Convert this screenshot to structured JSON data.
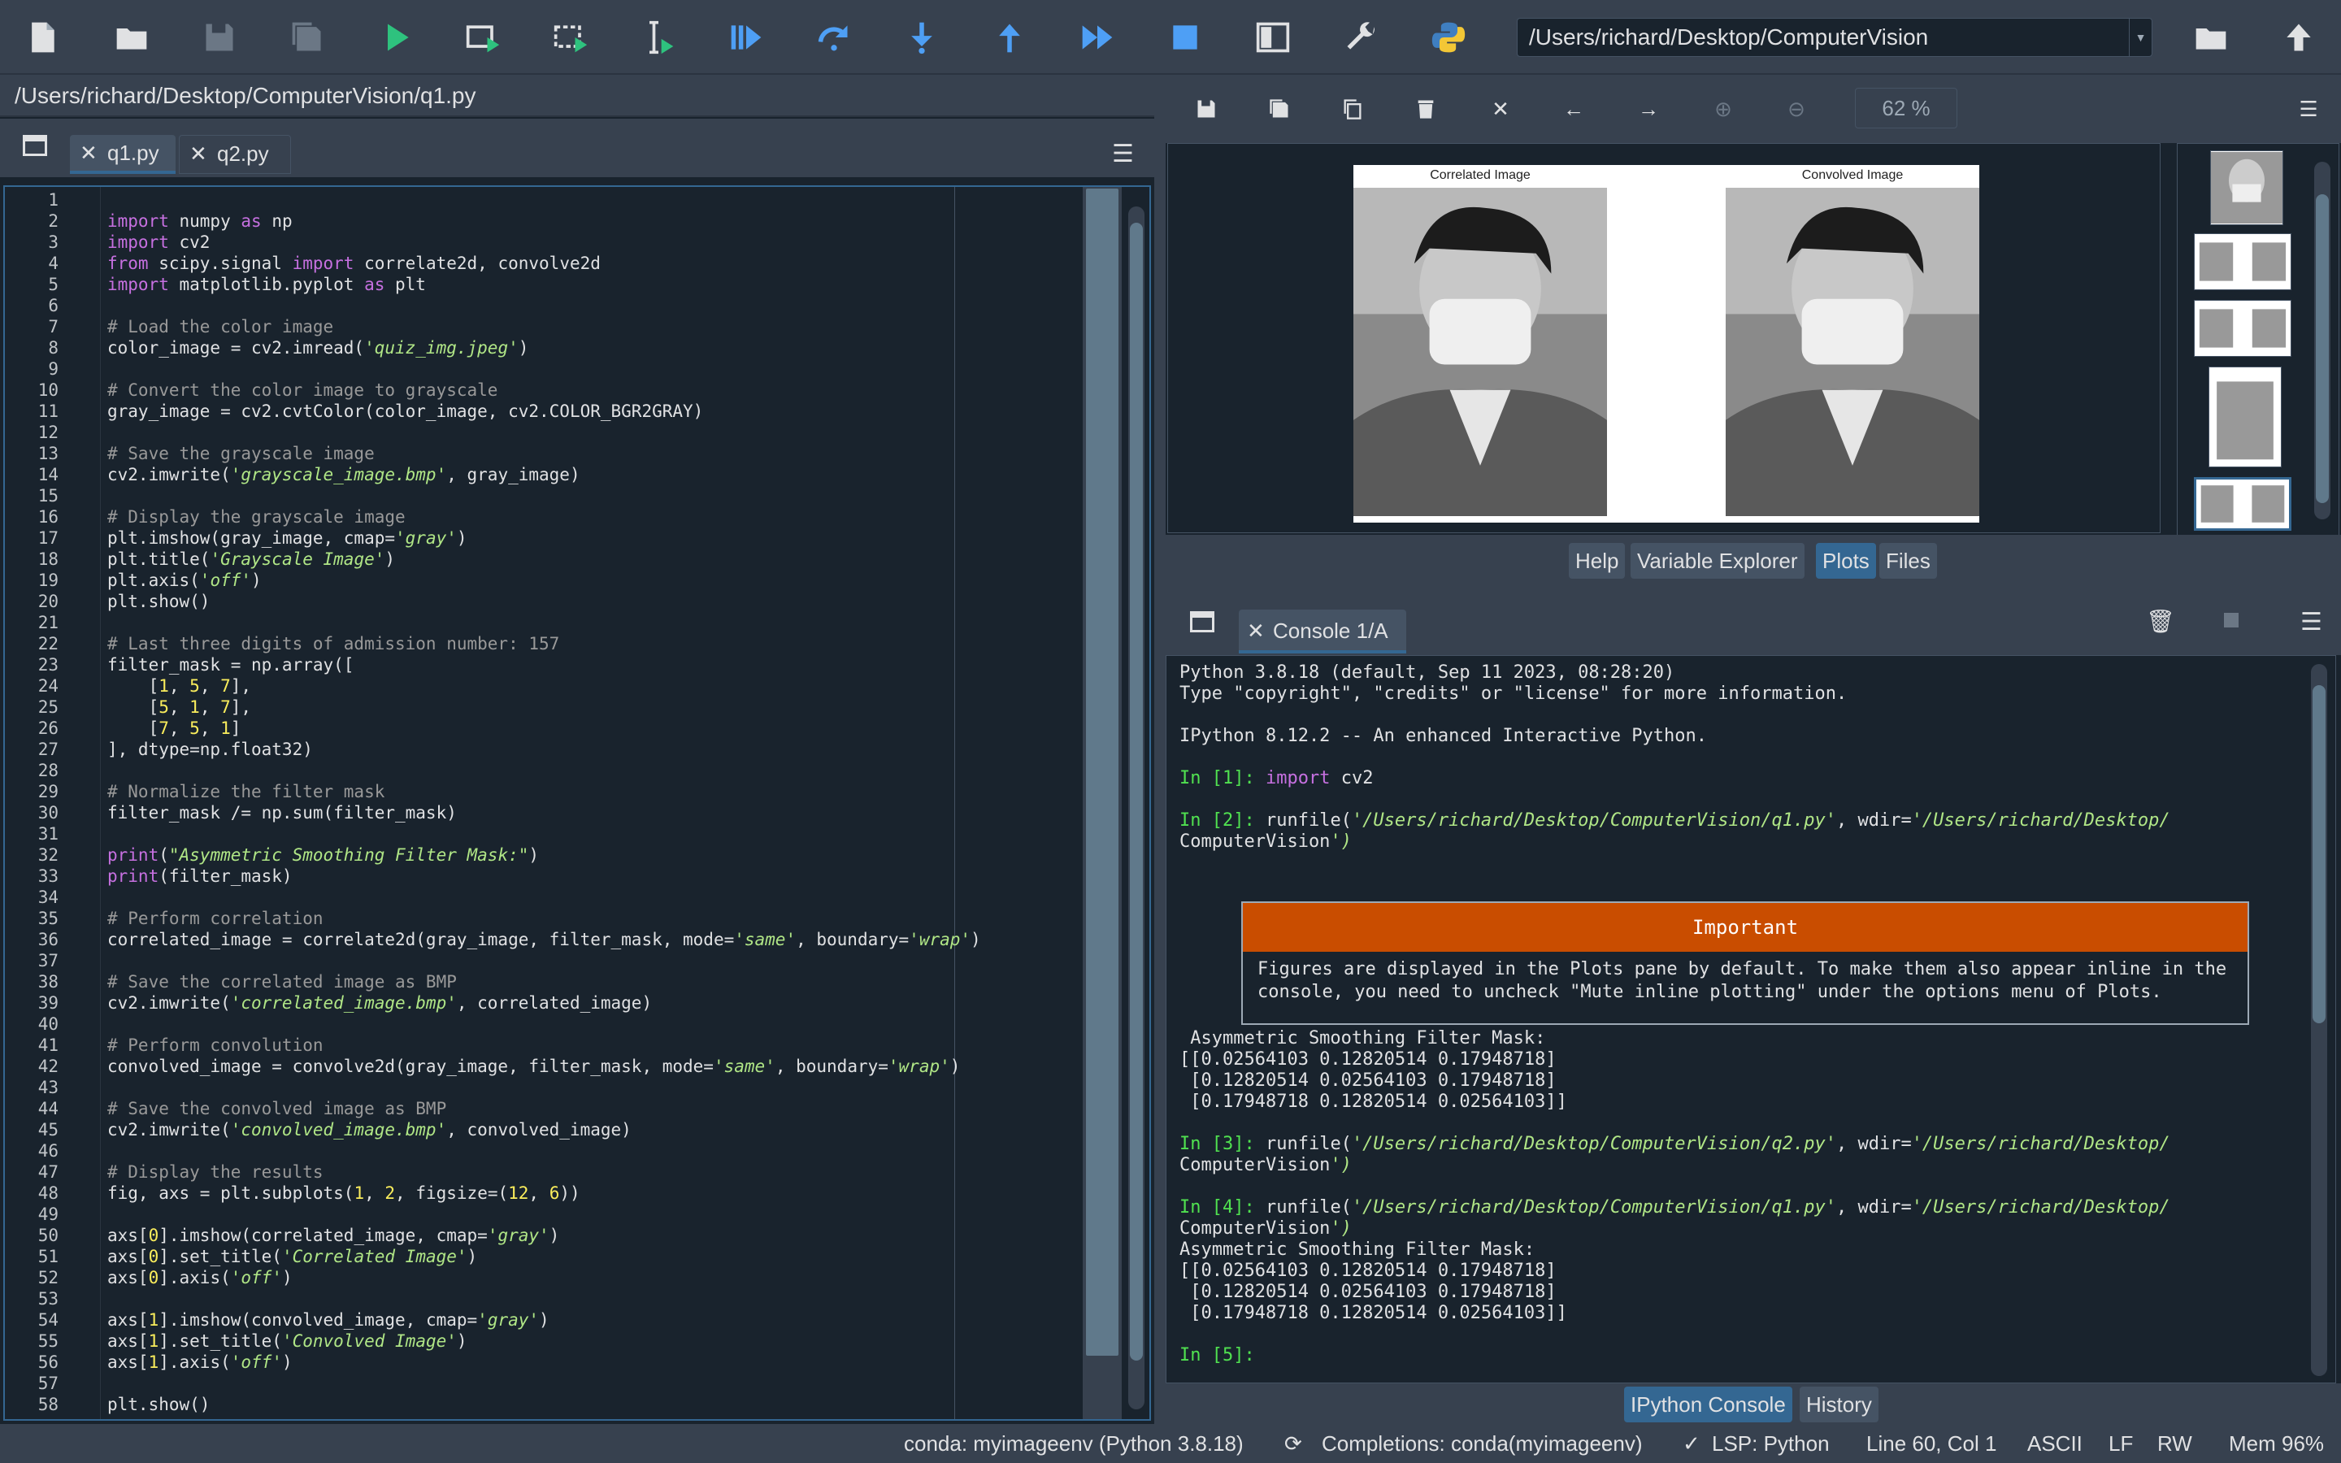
{
  "toolbar": {
    "working_dir": "/Users/richard/Desktop/ComputerVision",
    "icons": [
      "new-file-icon",
      "open-file-icon",
      "save-icon",
      "save-all-icon",
      "run-icon",
      "run-cell-icon",
      "run-cell-advance-icon",
      "run-selection-icon",
      "debug-icon",
      "step-over-icon",
      "step-into-icon",
      "step-out-icon",
      "continue-icon",
      "stop-icon",
      "maximize-pane-icon",
      "preferences-icon",
      "python-path-icon"
    ]
  },
  "editor": {
    "path": "/Users/richard/Desktop/ComputerVision/q1.py",
    "tabs": [
      {
        "label": "q1.py",
        "active": true
      },
      {
        "label": "q2.py",
        "active": false
      }
    ],
    "lines": [
      "",
      "import numpy as np",
      "import cv2",
      "from scipy.signal import correlate2d, convolve2d",
      "import matplotlib.pyplot as plt",
      "",
      "# Load the color image",
      "color_image = cv2.imread('quiz_img.jpeg')",
      "",
      "# Convert the color image to grayscale",
      "gray_image = cv2.cvtColor(color_image, cv2.COLOR_BGR2GRAY)",
      "",
      "# Save the grayscale image",
      "cv2.imwrite('grayscale_image.bmp', gray_image)",
      "",
      "# Display the grayscale image",
      "plt.imshow(gray_image, cmap='gray')",
      "plt.title('Grayscale Image')",
      "plt.axis('off')",
      "plt.show()",
      "",
      "# Last three digits of admission number: 157",
      "filter_mask = np.array([",
      "    [1, 5, 7],",
      "    [5, 1, 7],",
      "    [7, 5, 1]",
      "], dtype=np.float32)",
      "",
      "# Normalize the filter mask",
      "filter_mask /= np.sum(filter_mask)",
      "",
      "print(\"Asymmetric Smoothing Filter Mask:\")",
      "print(filter_mask)",
      "",
      "# Perform correlation",
      "correlated_image = correlate2d(gray_image, filter_mask, mode='same', boundary='wrap')",
      "",
      "# Save the correlated image as BMP",
      "cv2.imwrite('correlated_image.bmp', correlated_image)",
      "",
      "# Perform convolution",
      "convolved_image = convolve2d(gray_image, filter_mask, mode='same', boundary='wrap')",
      "",
      "# Save the convolved image as BMP",
      "cv2.imwrite('convolved_image.bmp', convolved_image)",
      "",
      "# Display the results",
      "fig, axs = plt.subplots(1, 2, figsize=(12, 6))",
      "",
      "axs[0].imshow(correlated_image, cmap='gray')",
      "axs[0].set_title('Correlated Image')",
      "axs[0].axis('off')",
      "",
      "axs[1].imshow(convolved_image, cmap='gray')",
      "axs[1].set_title('Convolved Image')",
      "axs[1].axis('off')",
      "",
      "plt.show()"
    ]
  },
  "plots": {
    "zoom": "62 %",
    "figure_titles": [
      "Correlated Image",
      "Convolved Image"
    ],
    "tabs": [
      "Help",
      "Variable Explorer",
      "Plots",
      "Files"
    ],
    "active_tab": "Plots"
  },
  "console": {
    "tab_label": "Console 1/A",
    "lines": [
      {
        "t": "Python 3.8.18 (default, Sep 11 2023, 08:28:20)",
        "k": "out"
      },
      {
        "t": "Type \"copyright\", \"credits\" or \"license\" for more information.",
        "k": "out"
      },
      {
        "t": "",
        "k": "out"
      },
      {
        "t": "IPython 8.12.2 -- An enhanced Interactive Python.",
        "k": "out"
      },
      {
        "t": "",
        "k": "out"
      },
      {
        "p": "In [1]: ",
        "t": "import cv2",
        "k": "in1"
      },
      {
        "t": "",
        "k": "out"
      },
      {
        "p": "In [2]: ",
        "t": "runfile('/Users/richard/Desktop/ComputerVision/q1.py', wdir='/Users/richard/Desktop/",
        "k": "run"
      },
      {
        "t": "ComputerVision')",
        "k": "run2"
      }
    ],
    "important_title": "Important",
    "important_body": "Figures are displayed in the Plots pane by default. To make them also appear inline in the\nconsole, you need to uncheck \"Mute inline plotting\" under the options menu of Plots.",
    "lines2": [
      {
        "t": " Asymmetric Smoothing Filter Mask:",
        "k": "out"
      },
      {
        "t": "[[0.02564103 0.12820514 0.17948718]",
        "k": "out"
      },
      {
        "t": " [0.12820514 0.02564103 0.17948718]",
        "k": "out"
      },
      {
        "t": " [0.17948718 0.12820514 0.02564103]]",
        "k": "out"
      },
      {
        "t": "",
        "k": "out"
      },
      {
        "p": "In [3]: ",
        "t": "runfile('/Users/richard/Desktop/ComputerVision/q2.py', wdir='/Users/richard/Desktop/",
        "k": "run"
      },
      {
        "t": "ComputerVision')",
        "k": "run2"
      },
      {
        "t": "",
        "k": "out"
      },
      {
        "p": "In [4]: ",
        "t": "runfile('/Users/richard/Desktop/ComputerVision/q1.py', wdir='/Users/richard/Desktop/",
        "k": "run"
      },
      {
        "t": "ComputerVision')",
        "k": "run2"
      },
      {
        "t": "Asymmetric Smoothing Filter Mask:",
        "k": "out"
      },
      {
        "t": "[[0.02564103 0.12820514 0.17948718]",
        "k": "out"
      },
      {
        "t": " [0.12820514 0.02564103 0.17948718]",
        "k": "out"
      },
      {
        "t": " [0.17948718 0.12820514 0.02564103]]",
        "k": "out"
      },
      {
        "t": "",
        "k": "out"
      },
      {
        "p": "In [5]: ",
        "t": "",
        "k": "in1"
      }
    ],
    "bottom_tabs": [
      "IPython Console",
      "History"
    ]
  },
  "statusbar": {
    "env": "conda: myimageenv (Python 3.8.18)",
    "completions": "Completions: conda(myimageenv)",
    "lsp": "LSP: Python",
    "position": "Line 60, Col 1",
    "encoding": "ASCII",
    "eol": "LF",
    "perm": "RW",
    "mem": "Mem 96%"
  },
  "colors": {
    "accent": "#346792",
    "important": "#c94d00",
    "prompt": "#50e150",
    "keyword": "#c670e0",
    "string": "#b0e686"
  }
}
